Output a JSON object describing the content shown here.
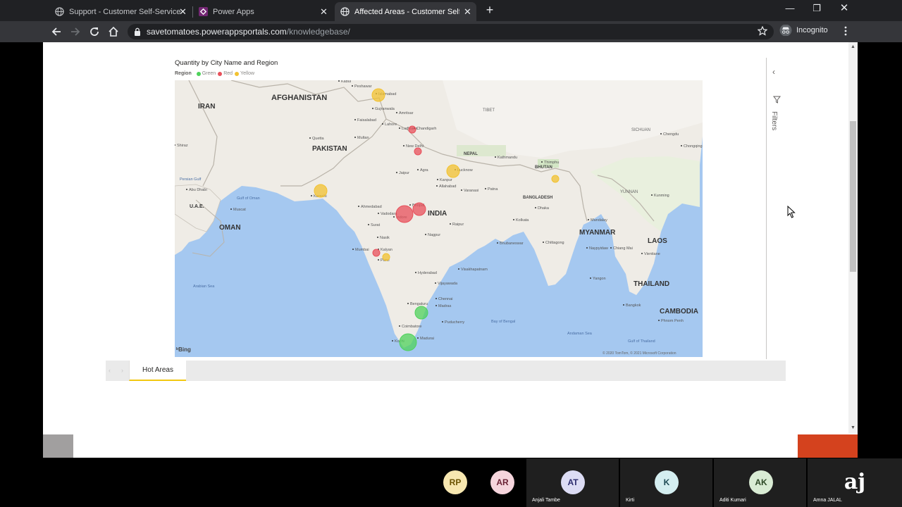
{
  "browser": {
    "tabs": [
      {
        "title": "Support - Customer Self-Service",
        "active": false,
        "icon": "globe-icon"
      },
      {
        "title": "Power Apps",
        "active": false,
        "icon": "power-apps-icon"
      },
      {
        "title": "Affected Areas - Customer Self-Se",
        "active": true,
        "icon": "globe-icon"
      }
    ],
    "url_host": "savetomatoes.powerappsportals.com",
    "url_path": "/knowledgebase/",
    "incognito_label": "Incognito"
  },
  "report": {
    "visual_title": "Quantity by City Name and Region",
    "legend_label": "Region",
    "filters_label": "Filters",
    "page_tab": "Hot Areas",
    "bing_label": "Bing",
    "map_copyright": "© 2020 TomTom, © 2021 Microsoft Corporation"
  },
  "colors": {
    "green": "#4fd25b",
    "red": "#e8505b",
    "yellow": "#f2c230",
    "accent_tab": "#f2c811"
  },
  "chart_data": {
    "type": "scatter",
    "title": "Quantity by City Name and Region",
    "legend": {
      "title": "Region",
      "entries": [
        "Green",
        "Red",
        "Yellow"
      ],
      "placement": "top-left"
    },
    "series": [
      {
        "name": "Green",
        "points": [
          {
            "city": "Bengaluru",
            "size": "medium"
          },
          {
            "city": "Madurai",
            "size": "large"
          }
        ]
      },
      {
        "name": "Red",
        "points": [
          {
            "city": "Ludhiana",
            "size": "small"
          },
          {
            "city": "New Delhi",
            "size": "small"
          },
          {
            "city": "Vadodara",
            "size": "large"
          },
          {
            "city": "Bhopal",
            "size": "medium"
          },
          {
            "city": "Mumbai",
            "size": "small"
          }
        ]
      },
      {
        "name": "Yellow",
        "points": [
          {
            "city": "Islamabad",
            "size": "medium"
          },
          {
            "city": "Lucknow",
            "size": "medium"
          },
          {
            "city": "Karachi",
            "size": "medium"
          },
          {
            "city": "Assam",
            "size": "small"
          },
          {
            "city": "Pune",
            "size": "small"
          }
        ]
      }
    ]
  },
  "map_labels": {
    "countries": [
      "AFGHANISTAN",
      "IRAN",
      "PAKISTAN",
      "INDIA",
      "OMAN",
      "U.A.E.",
      "MYANMAR",
      "LAOS",
      "THAILAND",
      "CAMBODIA",
      "NEPAL",
      "BHUTAN",
      "BANGLADESH",
      "TIBET",
      "SICHUAN",
      "YUNNAN"
    ],
    "seas": [
      "Arabian Sea",
      "Bay of Bengal",
      "Andaman Sea",
      "Gulf of Oman",
      "Persian Gulf",
      "Gulf of Thailand"
    ],
    "cities": [
      "Kabul",
      "Peshawar",
      "Islamabad",
      "Gujranwala",
      "Lahore",
      "Faisalabad",
      "Amritsar",
      "Ludhiana",
      "Chandigarh",
      "Multan",
      "Quetta",
      "Shiraz",
      "Abu Dhabi",
      "Muscat",
      "Karachi",
      "New Delhi",
      "Agra",
      "Jaipur",
      "Lucknow",
      "Kanpur",
      "Allahabad",
      "Varanasi",
      "Patna",
      "Kathmandu",
      "Thimphu",
      "Dhaka",
      "Kolkata",
      "Ahmedabad",
      "Vadodara",
      "Surat",
      "Bhopal",
      "Indore",
      "Nagpur",
      "Raipur",
      "Nasik",
      "Mumbai",
      "Kalyan",
      "Pune",
      "Hyderabad",
      "Vijayawada",
      "Visakhapatnam",
      "Bhubaneswar",
      "Bengaluru",
      "Chennai",
      "Madras",
      "Puducherry",
      "Coimbatore",
      "Madurai",
      "Kochi",
      "Chittagong",
      "Chengdu",
      "Kunming",
      "Chongqing",
      "Mandalay",
      "Naypyidaw",
      "Yangon",
      "Bangkok",
      "Vientiane",
      "Phnom Penh",
      "Chiang Mai"
    ]
  },
  "participants": [
    {
      "initials": "RP",
      "name": ""
    },
    {
      "initials": "AR",
      "name": ""
    },
    {
      "initials": "AT",
      "name": "Anjali Tambe"
    },
    {
      "initials": "K",
      "name": "Kirti"
    },
    {
      "initials": "AK",
      "name": "Aditi Kumari"
    },
    {
      "initials": "aj",
      "name": "Amna JALAL"
    }
  ]
}
